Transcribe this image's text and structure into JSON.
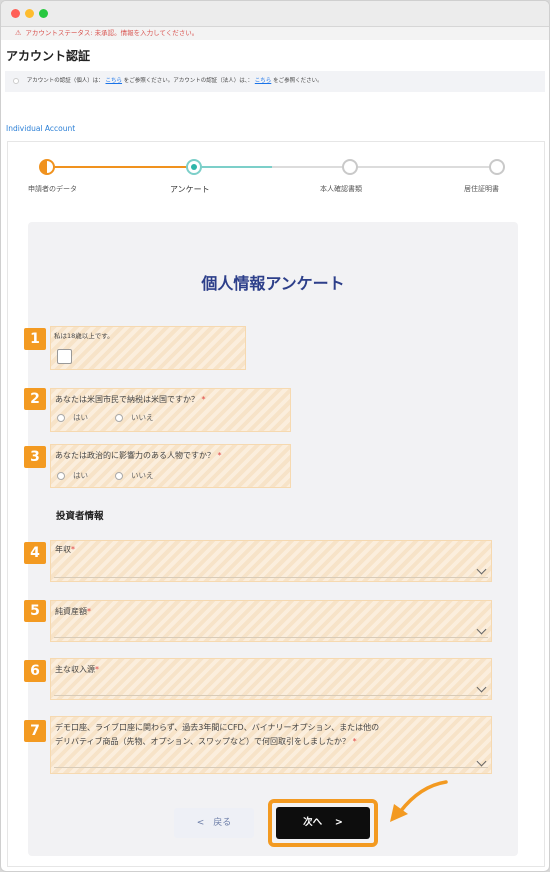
{
  "status": {
    "text": "アカウントステータス: 未承認。情報を入力してください。"
  },
  "page": {
    "title": "アカウント認証"
  },
  "notice": {
    "part1": "アカウントの認証（個人）は：",
    "link1": "こちら",
    "part2": "をご参照ください。アカウントの認証（法人）は、：",
    "link2": "こちら",
    "part3": "をご参照ください。"
  },
  "section_link": "Individual Account",
  "stepper": {
    "steps": [
      {
        "label": "申請者のデータ",
        "state": "done"
      },
      {
        "label": "アンケート",
        "state": "current"
      },
      {
        "label": "本人確認書類",
        "state": "pending"
      },
      {
        "label": "居住証明書",
        "state": "pending"
      }
    ]
  },
  "form": {
    "title": "個人情報アンケート",
    "q1": {
      "number": "1",
      "label": "私は18歳以上です。"
    },
    "q2": {
      "number": "2",
      "label": "あなたは米国市民で納税は米国ですか？",
      "required": "*",
      "opt_yes": "はい",
      "opt_no": "いいえ"
    },
    "q3": {
      "number": "3",
      "label": "あなたは政治的に影響力のある人物ですか？",
      "required": "*",
      "opt_yes": "はい",
      "opt_no": "いいえ"
    },
    "investor_heading": "投資者情報",
    "q4": {
      "number": "4",
      "label": "年収",
      "required": "*"
    },
    "q5": {
      "number": "5",
      "label": "純資産額",
      "required": "*"
    },
    "q6": {
      "number": "6",
      "label": "主な収入源",
      "required": "*"
    },
    "q7": {
      "number": "7",
      "label_line1": "デモ口座、ライブ口座に関わらず、過去3年間にCFD、バイナリーオプション、または他の",
      "label_line2": "デリバティブ商品（先物、オプション、スワップなど）で何回取引をしましたか？",
      "required": "*"
    }
  },
  "buttons": {
    "back": "<　戻る",
    "next": "次へ　 >"
  },
  "colors": {
    "accent_orange": "#f39a21",
    "teal": "#2eb5a9",
    "title_navy": "#2d3f8a",
    "warning_red": "#d9534f"
  }
}
